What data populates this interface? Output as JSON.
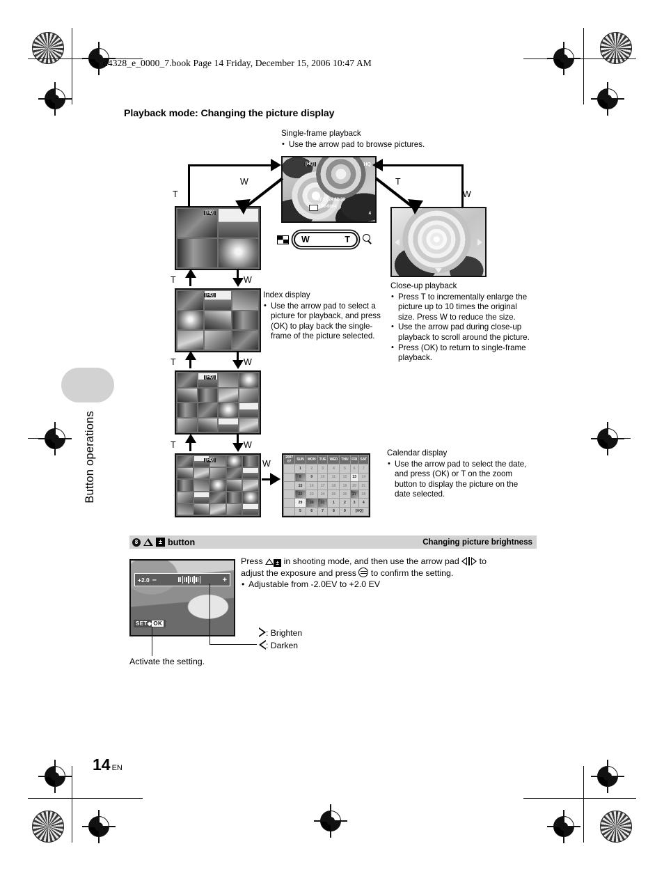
{
  "header": {
    "book_line": "d4328_e_0000_7.book  Page 14  Friday, December 15, 2006  10:47 AM"
  },
  "side_tab": {
    "label": "Button operations"
  },
  "page_footer": {
    "number": "14",
    "lang": "EN"
  },
  "main": {
    "title": "Playback mode: Changing the picture display"
  },
  "diagram": {
    "single_frame": {
      "heading": "Single-frame playback",
      "bullets": [
        "Use the arrow pad to browse pictures."
      ],
      "osd": {
        "mode": "[HQ]",
        "quality": "HQ",
        "datetime": "'07.07.24  12:30",
        "file": "100-0004",
        "number": "4"
      }
    },
    "index_display": {
      "heading": "Index display",
      "bullets": [
        "Use the arrow pad to select a picture for playback, and press (OK) to play back the single-frame of the picture selected."
      ],
      "screens": [
        "4",
        "9",
        "16",
        "25"
      ]
    },
    "closeup": {
      "heading": "Close-up playback",
      "bullets": [
        "Press T to incrementally enlarge the picture up to 10 times the original size. Press W to reduce the size.",
        "Use the arrow pad during close-up playback to scroll around the picture.",
        "Press (OK) to return to single-frame playback."
      ]
    },
    "calendar": {
      "heading": "Calendar display",
      "bullets": [
        "Use the arrow pad to select the date, and press (OK) or T on the zoom button to display the picture on the date selected."
      ],
      "weekdays": [
        "SUN",
        "MON",
        "TUE",
        "WED",
        "THU",
        "FRI",
        "SAT"
      ],
      "year": "2007",
      "month": "07",
      "weeks": [
        [
          "1",
          "2",
          "3",
          "4",
          "5",
          "6",
          "7"
        ],
        [
          "8",
          "9",
          "10",
          "11",
          "12",
          "13",
          "14"
        ],
        [
          "15",
          "16",
          "17",
          "18",
          "19",
          "20",
          "21"
        ],
        [
          "22",
          "23",
          "24",
          "25",
          "26",
          "27",
          "28"
        ],
        [
          "29",
          "30",
          "31",
          "1",
          "2",
          "3",
          "4"
        ],
        [
          "5",
          "6",
          "7",
          "8",
          "9",
          "",
          ""
        ]
      ],
      "footer_badge": "[HQ]"
    },
    "zoom_control": {
      "wide_label": "W",
      "tele_label": "T"
    },
    "flow_labels": {
      "w": "W",
      "t": "T"
    }
  },
  "bottom_section": {
    "band": {
      "number": "8",
      "button_label": "button",
      "right_title": "Changing picture brightness"
    },
    "body": {
      "line1_a": "Press",
      "line1_b": "in shooting mode, and then use the arrow pad",
      "line1_c": "to",
      "line2_a": "adjust the exposure and press",
      "line2_b": "to confirm the setting.",
      "bullet": "Adjustable from -2.0EV to +2.0 EV"
    },
    "exposure_screen": {
      "value": "+2.0",
      "minus": "–",
      "plus": "+",
      "set_label": "SET",
      "ok_label": "OK"
    },
    "callouts": {
      "brighten": ": Brighten",
      "darken": ": Darken",
      "activate": "Activate the setting."
    }
  }
}
